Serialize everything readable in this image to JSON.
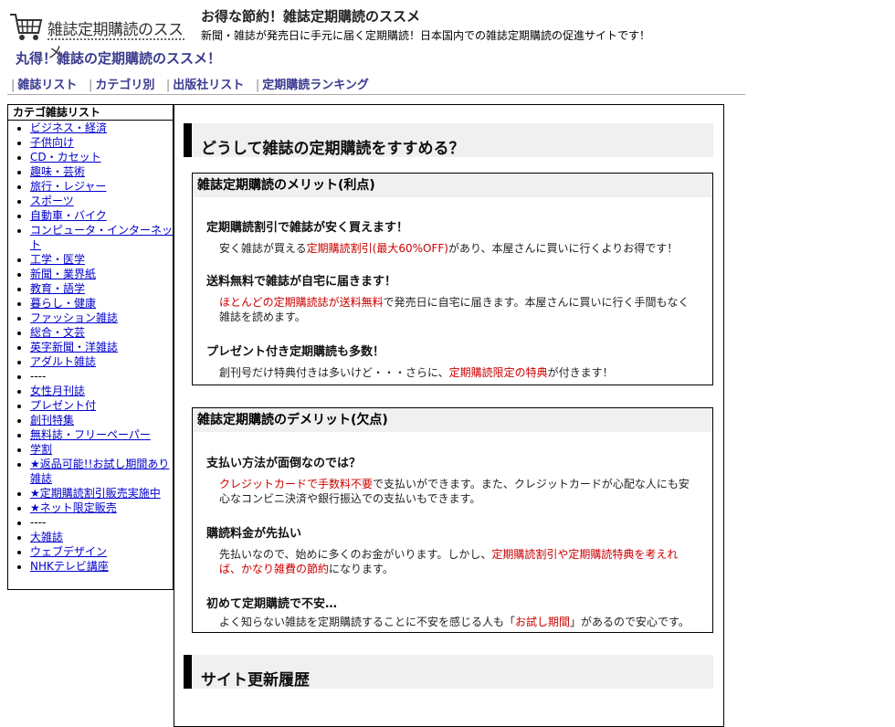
{
  "header": {
    "logo_text": "雑誌定期購読のススメ",
    "tagline": "お得な節約！雑誌定期購読のススメ",
    "subtagline": "新聞・雑誌が発売日に手元に届く定期購読！日本国内での雑誌定期購読の促進サイトです！",
    "site_title": "丸得！雑誌の定期購読のススメ！"
  },
  "nav": [
    {
      "label": "雑誌リスト"
    },
    {
      "label": "カテゴリ別"
    },
    {
      "label": "出版社リスト"
    },
    {
      "label": "定期購読ランキング"
    }
  ],
  "sidebar": {
    "heading": "カテゴ雑誌リスト",
    "items": [
      "ビジネス・経済",
      "子供向け",
      "CD・カセット",
      "趣味・芸術",
      "旅行・レジャー",
      "スポーツ",
      "自動車・バイク",
      "コンピュータ・インターネット",
      "工学・医学",
      "新聞・業界紙",
      "教育・語学",
      "暮らし・健康",
      "ファッション雑誌",
      "総合・文芸",
      "英字新聞・洋雑誌",
      "アダルト雑誌",
      "----",
      "女性月刊誌",
      "プレゼント付",
      "創刊特集",
      "無料誌・フリーペーパー",
      "学割",
      "★返品可能!!お試し期間あり雑誌",
      "★定期購読割引販売実施中",
      "★ネット限定販売",
      "----",
      "大雑誌",
      "ウェブデザイン",
      "NHKテレビ講座"
    ]
  },
  "main": {
    "section1_title": "どうして雑誌の定期購読をすすめる？",
    "merit": {
      "title": "雑誌定期購読のメリット(利点)",
      "items": [
        {
          "title": "定期購読割引で雑誌が安く買えます！",
          "pre": "安く雑誌が買える",
          "hl": "定期購読割引(最大60%OFF)",
          "post": "があり、本屋さんに買いに行くよりお得です！"
        },
        {
          "title": "送料無料で雑誌が自宅に届きます！",
          "pre": "",
          "hl": "ほとんどの定期購読誌が送料無料",
          "post": "で発売日に自宅に届きます。本屋さんに買いに行く手間もなく雑誌を読めます。"
        },
        {
          "title": "プレゼント付き定期購読も多数！",
          "pre": "創刊号だけ特典付きは多いけど・・・さらに、",
          "hl": "定期購読限定の特典",
          "post": "が付きます！"
        }
      ]
    },
    "demerit": {
      "title": "雑誌定期購読のデメリット(欠点)",
      "items": [
        {
          "title": "支払い方法が面倒なのでは？",
          "pre": "",
          "hl": "クレジットカードで手数料不要",
          "post": "で支払いができます。また、クレジットカードが心配な人にも安心なコンビニ決済や銀行振込での支払いもできます。"
        },
        {
          "title": "購読料金が先払い",
          "pre": "先払いなので、始めに多くのお金がいります。しかし、",
          "hl": "定期購読割引や定期購読特典を考えれば、かなり雑費の節約",
          "post": "になります。"
        },
        {
          "title": "初めて定期購読で不安…",
          "pre": "よく知らない雑誌を定期購読することに不安を感じる人も「",
          "hl": "お試し期間",
          "post": "」があるので安心です。"
        }
      ]
    },
    "section2_title": "サイト更新履歴"
  }
}
